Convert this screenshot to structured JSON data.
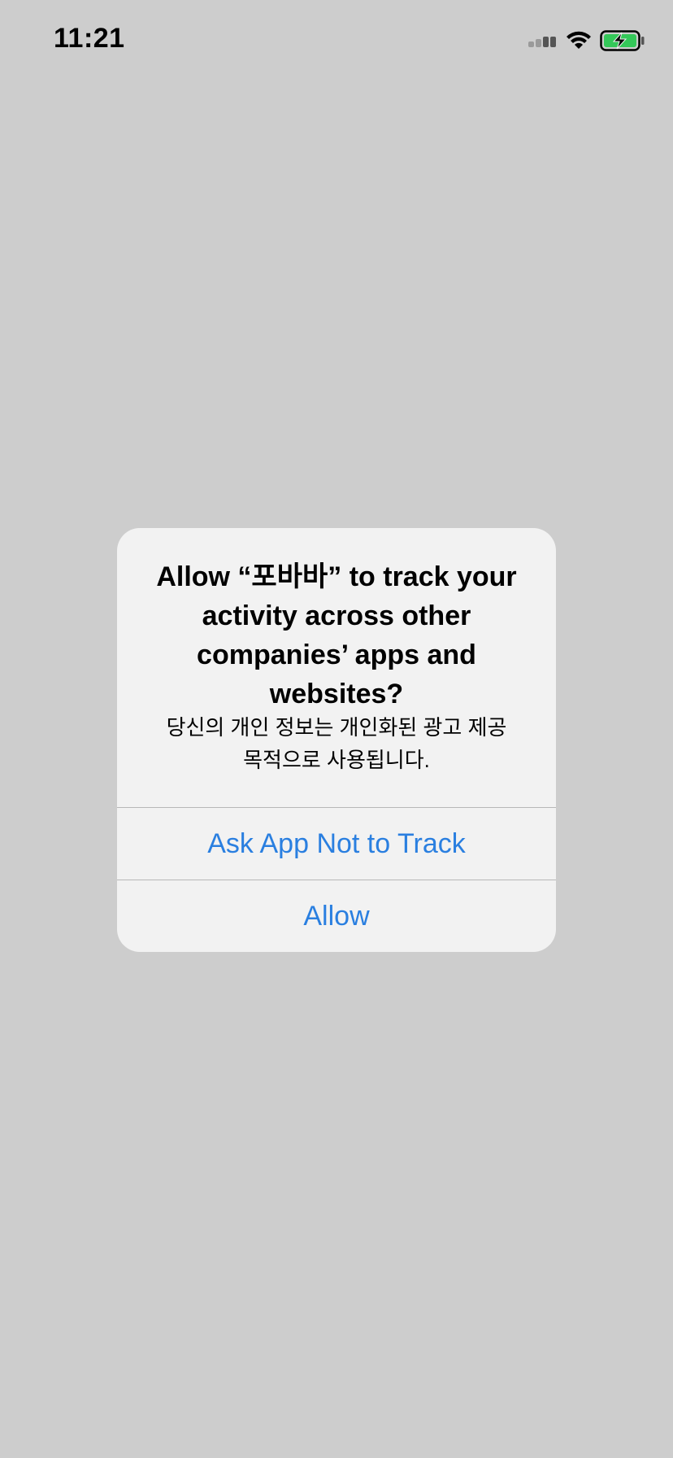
{
  "status_bar": {
    "time": "11:21",
    "icons": [
      "signal-icon",
      "wifi-icon",
      "battery-charging-icon"
    ],
    "battery_color": "#34c759"
  },
  "alert": {
    "title": "Allow “포바바” to track your activity across other companies’ apps and websites?",
    "message": "당신의 개인 정보는 개인화된 광고 제공 목적으로 사용됩니다.",
    "buttons": {
      "ask_not_to_track": "Ask App Not to Track",
      "allow": "Allow"
    },
    "button_color": "#2a7fe0",
    "background": "#f2f2f2"
  },
  "screen_background": "#cdcdcd"
}
